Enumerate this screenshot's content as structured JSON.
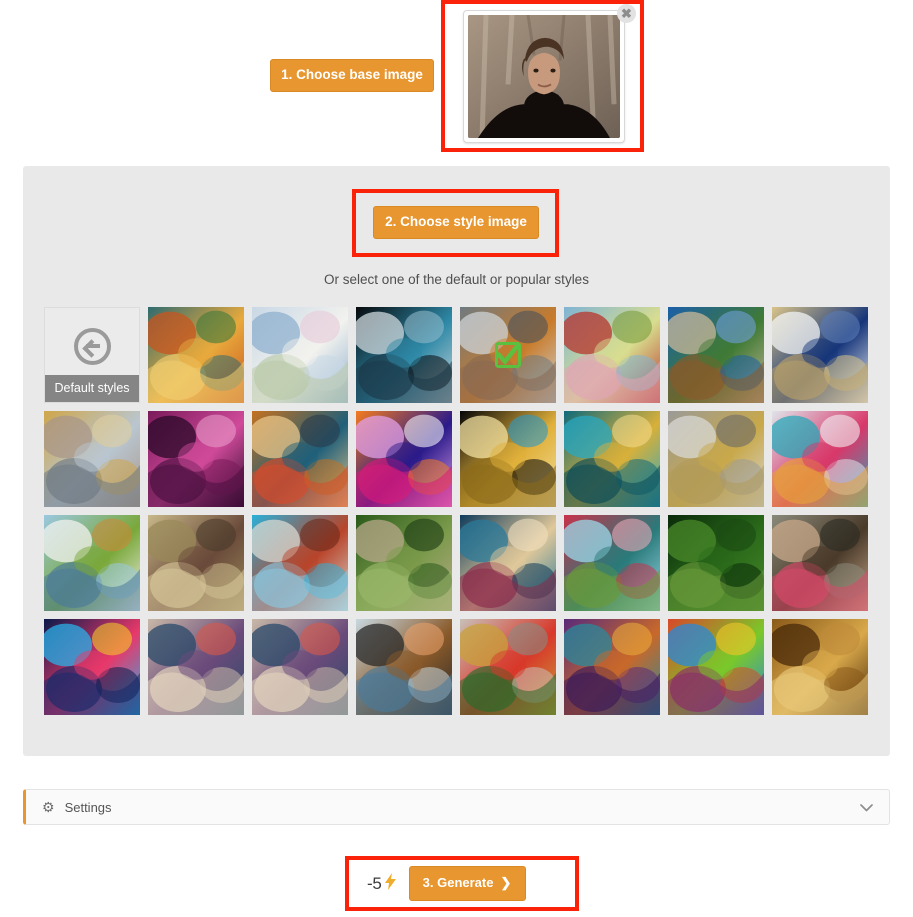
{
  "steps": {
    "base_image_label": "1. Choose base image",
    "style_image_label": "2. Choose style image",
    "generate_label": "3. Generate"
  },
  "base_image": {
    "remove_icon": "✖",
    "alt": "portrait-photo-man-in-black-turtleneck-in-winter-forest"
  },
  "styles_panel": {
    "hint_text": "Or select one of the default or popular styles",
    "default_tile_caption": "Default styles",
    "back_icon": "back-arrow-circle-icon",
    "selected_index": 4,
    "selected_check_icon": "green-checkmark",
    "tiles": [
      {
        "name": "default-styles",
        "caption": "Default styles",
        "kind": "back"
      },
      {
        "name": "stained-glass-window-sunset",
        "colors": [
          "#2f6b6f",
          "#e8a93c",
          "#c8551f",
          "#3f7a3a",
          "#f0cd70"
        ]
      },
      {
        "name": "impressionist-white-blossoms",
        "colors": [
          "#c9d8e6",
          "#f2f2ee",
          "#8fb0cf",
          "#e8c9d8",
          "#b9c9a8"
        ]
      },
      {
        "name": "ornate-silver-blue-portrait-medallion",
        "colors": [
          "#07090c",
          "#2d88a6",
          "#cfd8dc",
          "#8fb8c8",
          "#1b3b4a"
        ]
      },
      {
        "name": "two-elderly-women-seated-painting",
        "colors": [
          "#6f7a80",
          "#c97b2a",
          "#cdd3d6",
          "#49525a",
          "#8a6a52"
        ]
      },
      {
        "name": "fairytale-cottage-autumn-trees",
        "colors": [
          "#7fb4d4",
          "#d8dd8f",
          "#b8342c",
          "#7a9c3e",
          "#e0a5b5"
        ]
      },
      {
        "name": "mediterranean-alley-arch-garden",
        "colors": [
          "#1b5fa8",
          "#3f7a35",
          "#c9b898",
          "#6f9fd8",
          "#8a5a2a"
        ]
      },
      {
        "name": "great-wave-japanese-woodblock",
        "colors": [
          "#d9c489",
          "#16357a",
          "#f2f4f6",
          "#5a7bb5",
          "#b8a06a"
        ]
      },
      {
        "name": "gold-silver-baroque-floral-relief",
        "colors": [
          "#cfa64a",
          "#b9c6d0",
          "#a9978a",
          "#e0cfa0",
          "#6f7a84"
        ]
      },
      {
        "name": "magenta-glowing-rose",
        "colors": [
          "#7a1a5a",
          "#d04a9a",
          "#2a0a2a",
          "#e89ac8",
          "#4a1040"
        ]
      },
      {
        "name": "painted-tiger-face",
        "colors": [
          "#c4711f",
          "#1f5f7a",
          "#e8c68a",
          "#2a3a4a",
          "#d84a2a"
        ]
      },
      {
        "name": "orange-crescent-gradient-abstract",
        "colors": [
          "#f47b20",
          "#2a1a8a",
          "#e0a0e8",
          "#f2f2f8",
          "#d81a7a"
        ]
      },
      {
        "name": "golden-sparkle-fractal-on-black",
        "colors": [
          "#050508",
          "#e0b03a",
          "#f2e0a0",
          "#2a9ac8",
          "#8a6a1a"
        ]
      },
      {
        "name": "gold-butterflies-teal-ornament",
        "colors": [
          "#0f6a7a",
          "#d8b03a",
          "#2aa8c0",
          "#f0d88a",
          "#0a4a58"
        ]
      },
      {
        "name": "golden-crowned-woman-grayscale-portrait",
        "colors": [
          "#9a9a98",
          "#c8a84a",
          "#d8d8d4",
          "#6a6a68",
          "#b09a5a"
        ]
      },
      {
        "name": "colorful-snowmen-winter-scene",
        "colors": [
          "#dfe4ea",
          "#d8386a",
          "#2aa8b8",
          "#f0f2f4",
          "#e8a03a"
        ]
      },
      {
        "name": "naive-coastal-village-landscape",
        "colors": [
          "#9ac8e0",
          "#7aa83a",
          "#f2f2ee",
          "#c88a3a",
          "#4a7a9a"
        ]
      },
      {
        "name": "impressionist-old-stone-house",
        "colors": [
          "#c8b88a",
          "#6a4a3a",
          "#9a8a5a",
          "#4a3a2a",
          "#d8c89a"
        ]
      },
      {
        "name": "surreal-fork-towers-blue-sky",
        "colors": [
          "#2ab0d8",
          "#b8442a",
          "#d8d8d0",
          "#6a2a1a",
          "#8ac8e0"
        ]
      },
      {
        "name": "green-forest-path-trees",
        "colors": [
          "#2a5a1a",
          "#7a9a4a",
          "#b8a88a",
          "#1a3a12",
          "#9ab86a"
        ]
      },
      {
        "name": "mermaid-underwater-starry-illustration",
        "colors": [
          "#0f3a5a",
          "#e0c89a",
          "#2a7a9a",
          "#f0e0c0",
          "#8a2a4a"
        ]
      },
      {
        "name": "cartoon-woman-on-sofa-with-cat",
        "colors": [
          "#c8324a",
          "#2a7a7a",
          "#9ad8e8",
          "#e8a8b8",
          "#6a9a3a"
        ]
      },
      {
        "name": "dark-green-leaves-macro",
        "colors": [
          "#0a2a0a",
          "#2a6a1a",
          "#4a8a2a",
          "#1a4a12",
          "#6a9a3a"
        ]
      },
      {
        "name": "painted-wolfhound-dog-portrait",
        "colors": [
          "#8a8a7a",
          "#4a3a2a",
          "#c8a88a",
          "#2a2a22",
          "#d8486a"
        ]
      },
      {
        "name": "neon-cyberpunk-city-signs",
        "colors": [
          "#0a1a4a",
          "#e8386a",
          "#2ab0e8",
          "#f0c82a",
          "#1a2a6a"
        ]
      },
      {
        "name": "painted-closeup-eye-left",
        "colors": [
          "#c8b8a8",
          "#6a4a7a",
          "#2a4a6a",
          "#d8584a",
          "#e8d8c0"
        ]
      },
      {
        "name": "painted-closeup-eye-right",
        "colors": [
          "#c8b8a8",
          "#6a4a7a",
          "#2a4a6a",
          "#d8584a",
          "#e8d8c0"
        ]
      },
      {
        "name": "steampunk-woman-with-goggles",
        "colors": [
          "#c8d8e0",
          "#8a5a2a",
          "#2a2a2a",
          "#e8a06a",
          "#4a7a9a"
        ]
      },
      {
        "name": "ornate-golden-glassware-still-life",
        "colors": [
          "#c8c0b8",
          "#d8382a",
          "#c8a03a",
          "#8a8a82",
          "#2a6a2a"
        ]
      },
      {
        "name": "purple-mandala-ornamental-pattern",
        "colors": [
          "#5a2a7a",
          "#c8682a",
          "#2a8a9a",
          "#e8a83a",
          "#3a1a5a"
        ]
      },
      {
        "name": "vibrant-tribal-collage-figure",
        "colors": [
          "#d8482a",
          "#7ac82a",
          "#2a8ad8",
          "#f0c82a",
          "#8a2a6a"
        ]
      },
      {
        "name": "golden-sand-dune-desert",
        "colors": [
          "#8a5a1a",
          "#d8a84a",
          "#4a2a0a",
          "#c08a3a",
          "#e8c87a"
        ]
      }
    ]
  },
  "settings": {
    "label": "Settings",
    "gear_icon": "⚙",
    "chevron_icon": "⌄"
  },
  "generate": {
    "cost": "-5",
    "bolt_icon": "⚡",
    "chevron_icon": "❯"
  },
  "colors": {
    "accent_orange": "#e8962f",
    "annotation_red": "#fa2208",
    "panel_gray": "#e9e9e9",
    "check_green": "#5bbf3f",
    "bolt_yellow": "#f0ac2c"
  }
}
